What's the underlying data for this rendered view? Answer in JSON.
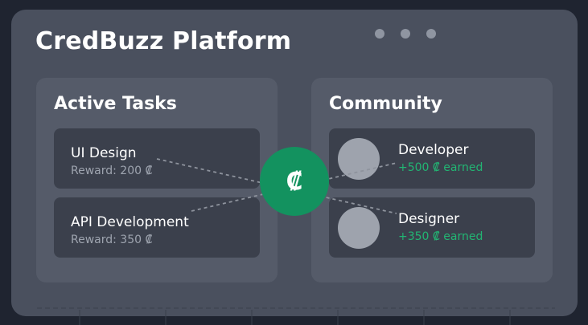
{
  "window": {
    "title": "CredBuzz Platform"
  },
  "tasks": {
    "title": "Active Tasks",
    "items": [
      {
        "title": "UI Design",
        "reward": "Reward: 200 ₡"
      },
      {
        "title": "API Development",
        "reward": "Reward: 350 ₡"
      }
    ]
  },
  "community": {
    "title": "Community",
    "members": [
      {
        "role": "Developer",
        "earned": "+500 ₡ earned"
      },
      {
        "role": "Designer",
        "earned": "+350 ₡ earned"
      }
    ]
  },
  "hub": {
    "symbol": "₡"
  },
  "colors": {
    "background": "#1f2430",
    "window": "#4a505e",
    "panel": "#555b69",
    "card": "#3b404c",
    "hub": "#13925f",
    "earned": "#22b573"
  }
}
